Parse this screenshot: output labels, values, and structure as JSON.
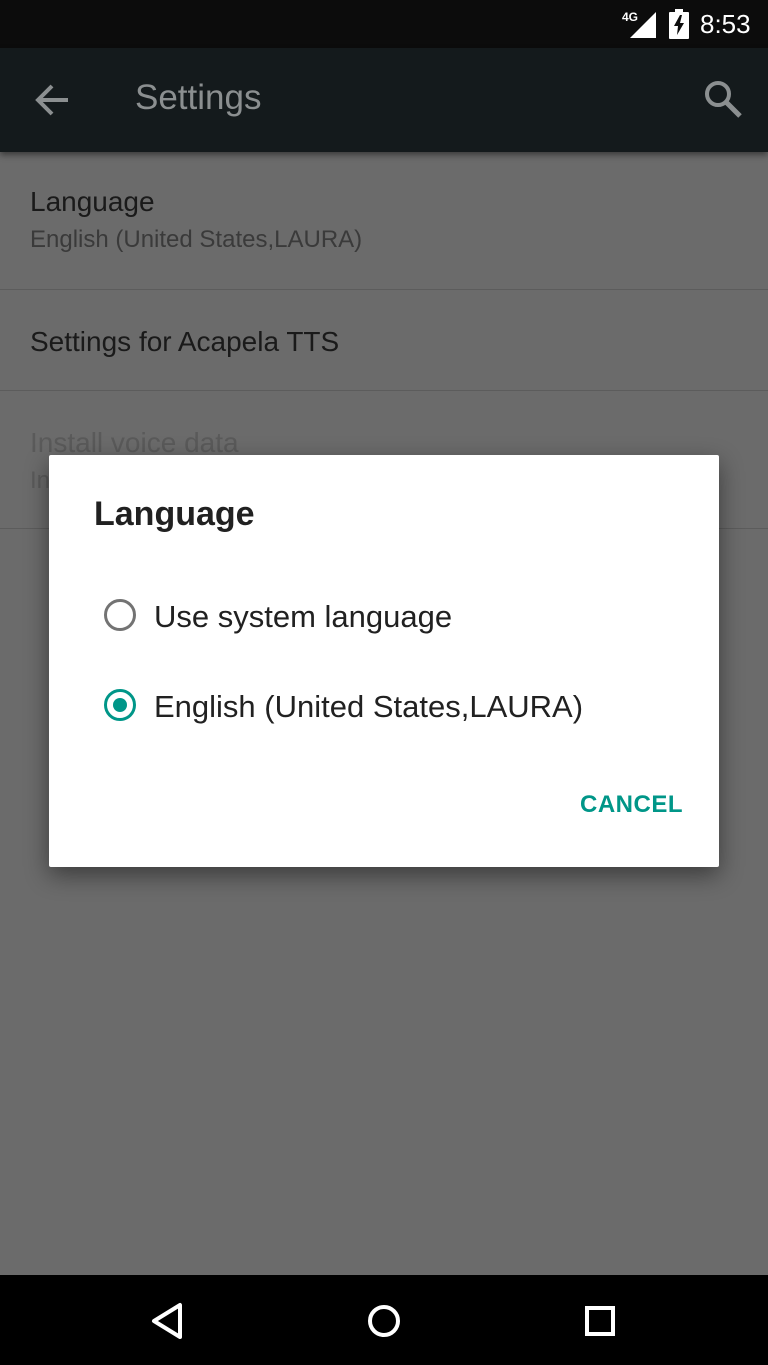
{
  "status_bar": {
    "network": "4G",
    "time": "8:53"
  },
  "app_bar": {
    "title": "Settings"
  },
  "settings": [
    {
      "title": "Language",
      "summary": "English (United States,LAURA)",
      "enabled": true
    },
    {
      "title": "Settings for Acapela TTS",
      "summary": "",
      "enabled": true
    },
    {
      "title": "Install voice data",
      "summary": "In",
      "enabled": false
    }
  ],
  "dialog": {
    "title": "Language",
    "options": [
      {
        "label": "Use system language",
        "selected": false
      },
      {
        "label": "English (United States,LAURA)",
        "selected": true
      }
    ],
    "cancel_label": "CANCEL"
  },
  "colors": {
    "accent": "#009688",
    "scrim_background": "#6b6b6b",
    "app_bar": "#141a1c"
  },
  "icons": {
    "status": [
      "signal-icon",
      "battery-charging-icon"
    ],
    "app_bar": [
      "back-arrow-icon",
      "search-icon"
    ],
    "nav": [
      "nav-back-icon",
      "nav-home-icon",
      "nav-recents-icon"
    ]
  }
}
